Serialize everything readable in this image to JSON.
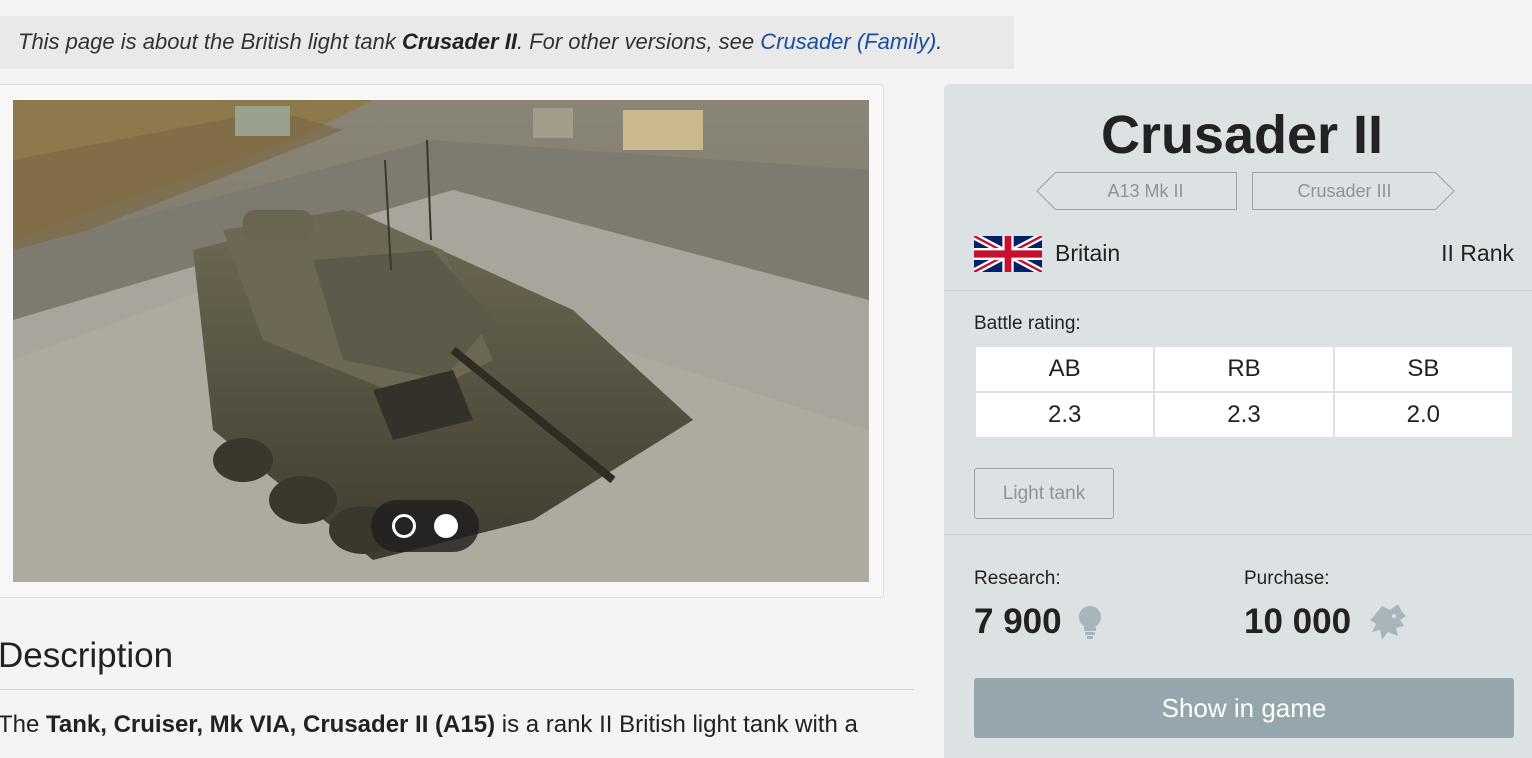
{
  "hatnote": {
    "prefix": "This page is about the British light tank ",
    "subject": "Crusader II",
    "middle": ". For other versions, see ",
    "link": "Crusader (Family)",
    "suffix": "."
  },
  "gallery": {
    "slide_count": 2,
    "active_slide": 2
  },
  "description": {
    "heading": "Description",
    "text_prefix": "The ",
    "text_bold": "Tank, Cruiser, Mk VIA, Crusader II (A15)",
    "text_suffix": " is a rank II British light tank with a"
  },
  "infobox": {
    "title": "Crusader II",
    "prev_vehicle": "A13 Mk II",
    "next_vehicle": "Crusader III",
    "nation": "Britain",
    "rank": "II Rank",
    "battle_rating_label": "Battle rating:",
    "br_headers": [
      "AB",
      "RB",
      "SB"
    ],
    "br_values": [
      "2.3",
      "2.3",
      "2.0"
    ],
    "vehicle_class": "Light tank",
    "research_label": "Research:",
    "research_value": "7 900",
    "purchase_label": "Purchase:",
    "purchase_value": "10 000",
    "show_in_game": "Show in game"
  },
  "icons": {
    "research": "lightbulb-icon",
    "purchase": "silver-lion-icon",
    "flag": "union-jack-flag"
  },
  "colors": {
    "link": "#1a4ea0",
    "infobox_bg": "#dce1e4",
    "button_bg": "#95a6ad",
    "muted": "#8a949a"
  }
}
